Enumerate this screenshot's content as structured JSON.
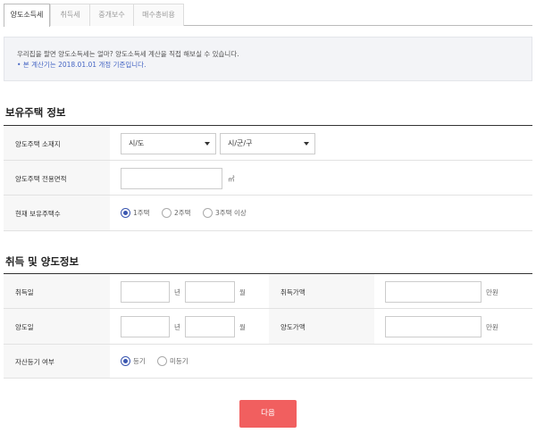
{
  "tabs": [
    {
      "label": "양도소득세",
      "active": true
    },
    {
      "label": "취득세",
      "active": false
    },
    {
      "label": "중개보수",
      "active": false
    },
    {
      "label": "매수총비용",
      "active": false
    }
  ],
  "notice": {
    "line1": "우리집을 팔면 양도소득세는 얼마? 양도소득세 계산을 직접 해보실 수 있습니다.",
    "line2": "• 본 계산기는 2018.01.01 개정 기준입니다."
  },
  "section1": {
    "title": "보유주택 정보",
    "location_label": "양도주택 소재지",
    "sido_value": "시/도",
    "sigungu_value": "시/군/구",
    "area_label": "양도주택 전용면적",
    "area_unit": "㎡",
    "count_label": "현재 보유주택수",
    "count_options": [
      "1주택",
      "2주택",
      "3주택 이상"
    ],
    "count_selected": "1주택"
  },
  "section2": {
    "title": "취득 및 양도정보",
    "acq_date_label": "취득일",
    "transfer_date_label": "양도일",
    "year_unit": "년",
    "month_unit": "월",
    "acq_price_label": "취득가액",
    "transfer_price_label": "양도가액",
    "price_unit": "만원",
    "registration_label": "자산등기 여부",
    "registration_options": [
      "등기",
      "미등기"
    ],
    "registration_selected": "등기"
  },
  "next_button": "다음",
  "colors": {
    "accent": "#3a56b0",
    "button": "#f15f5f",
    "notice_text": "#4666c4"
  }
}
